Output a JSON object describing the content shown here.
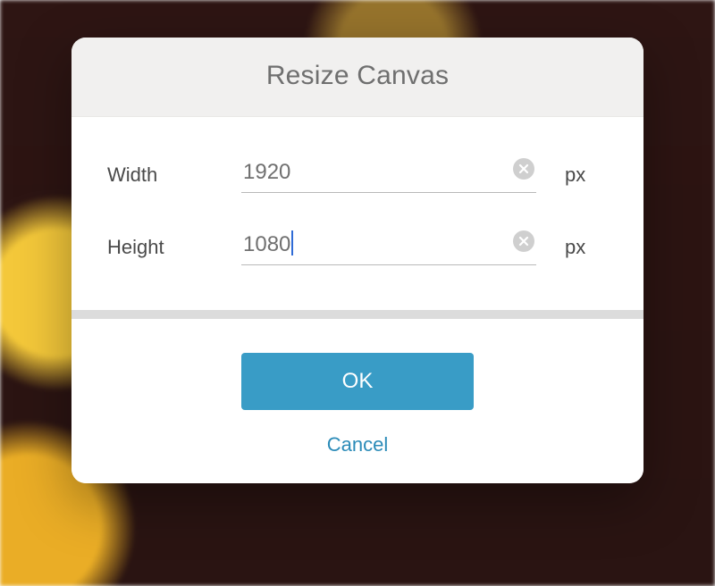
{
  "dialog": {
    "title": "Resize Canvas",
    "width": {
      "label": "Width",
      "value": "1920",
      "unit": "px"
    },
    "height": {
      "label": "Height",
      "value": "1080",
      "unit": "px"
    },
    "ok_label": "OK",
    "cancel_label": "Cancel"
  }
}
